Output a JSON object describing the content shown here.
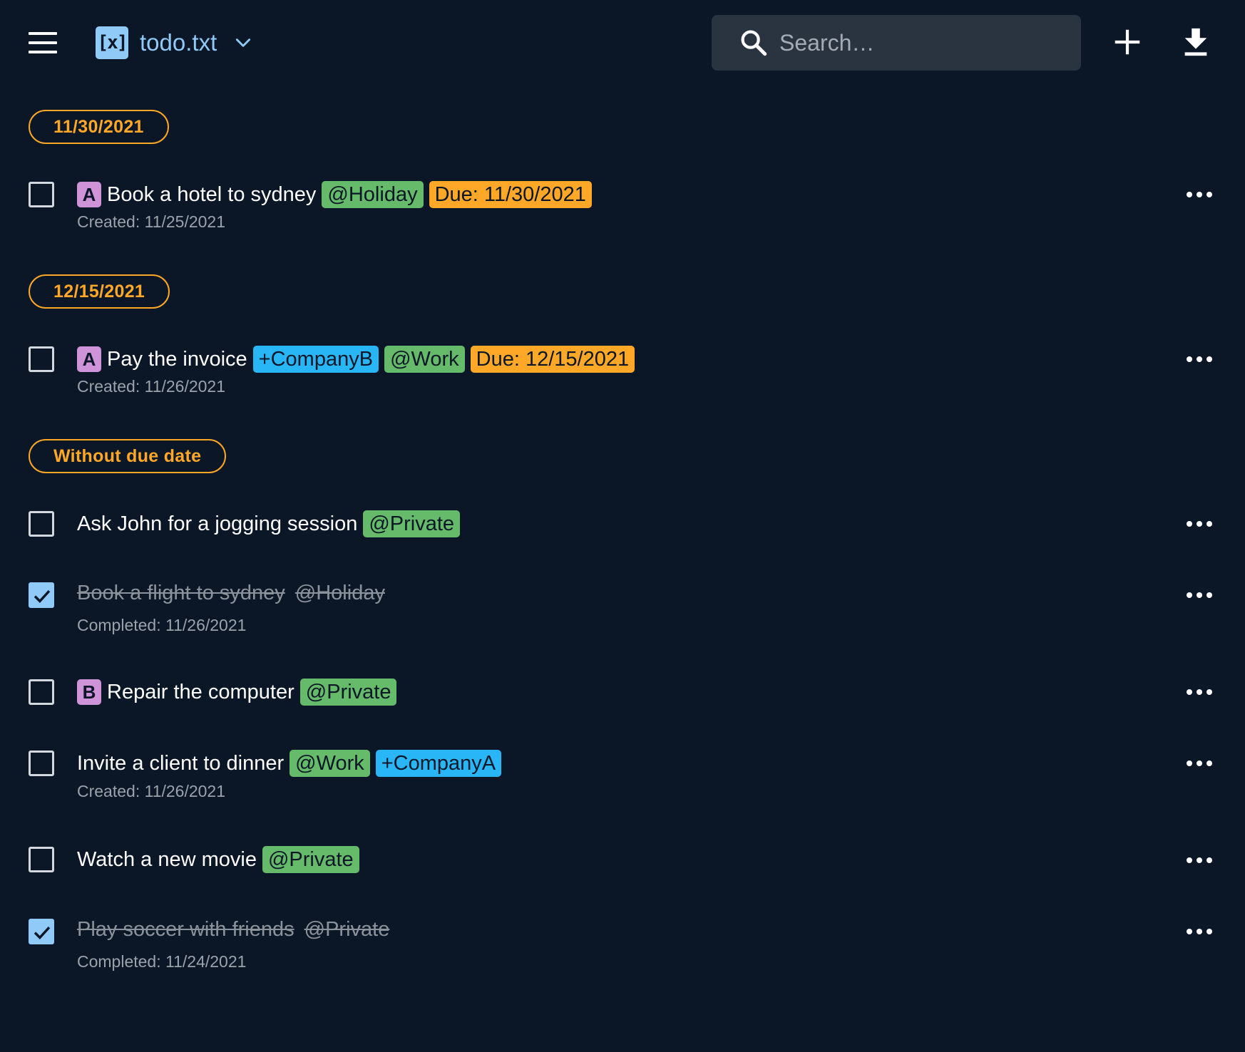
{
  "header": {
    "logo_text": "[x]",
    "file_name": "todo.txt",
    "search_placeholder": "Search…",
    "icons": [
      "menu-icon",
      "chevron-down-icon",
      "search-icon",
      "plus-icon",
      "download-icon"
    ]
  },
  "colors": {
    "background": "#0b1727",
    "accent": "#90caf9",
    "group_chip": "#ffa726",
    "priority": "#ce93d8",
    "context_tag": "#66bb6a",
    "project_tag": "#29b6f6",
    "due_tag": "#ffa726"
  },
  "groups": [
    {
      "label": "11/30/2021",
      "tasks": [
        {
          "checked": false,
          "priority": "A",
          "text": "Book a hotel to sydney",
          "tags": [
            {
              "type": "context",
              "text": "@Holiday"
            },
            {
              "type": "due",
              "text": "Due: 11/30/2021"
            }
          ],
          "meta": "Created: 11/25/2021"
        }
      ]
    },
    {
      "label": "12/15/2021",
      "tasks": [
        {
          "checked": false,
          "priority": "A",
          "text": "Pay the invoice",
          "tags": [
            {
              "type": "project",
              "text": "+CompanyB"
            },
            {
              "type": "context",
              "text": "@Work"
            },
            {
              "type": "due",
              "text": "Due: 12/15/2021"
            }
          ],
          "meta": "Created: 11/26/2021"
        }
      ]
    },
    {
      "label": "Without due date",
      "tasks": [
        {
          "checked": false,
          "text": "Ask John for a jogging session",
          "tags": [
            {
              "type": "context",
              "text": "@Private"
            }
          ]
        },
        {
          "checked": true,
          "text": "Book a flight to sydney",
          "done_tag": "@Holiday",
          "meta": "Completed: 11/26/2021"
        },
        {
          "checked": false,
          "priority": "B",
          "text": "Repair the computer",
          "tags": [
            {
              "type": "context",
              "text": "@Private"
            }
          ]
        },
        {
          "checked": false,
          "text": "Invite a client to dinner",
          "tags": [
            {
              "type": "context",
              "text": "@Work"
            },
            {
              "type": "project",
              "text": "+CompanyA"
            }
          ],
          "meta": "Created: 11/26/2021"
        },
        {
          "checked": false,
          "text": "Watch a new movie",
          "tags": [
            {
              "type": "context",
              "text": "@Private"
            }
          ]
        },
        {
          "checked": true,
          "text": "Play soccer with friends",
          "done_tag": "@Private",
          "meta": "Completed: 11/24/2021"
        }
      ]
    }
  ]
}
